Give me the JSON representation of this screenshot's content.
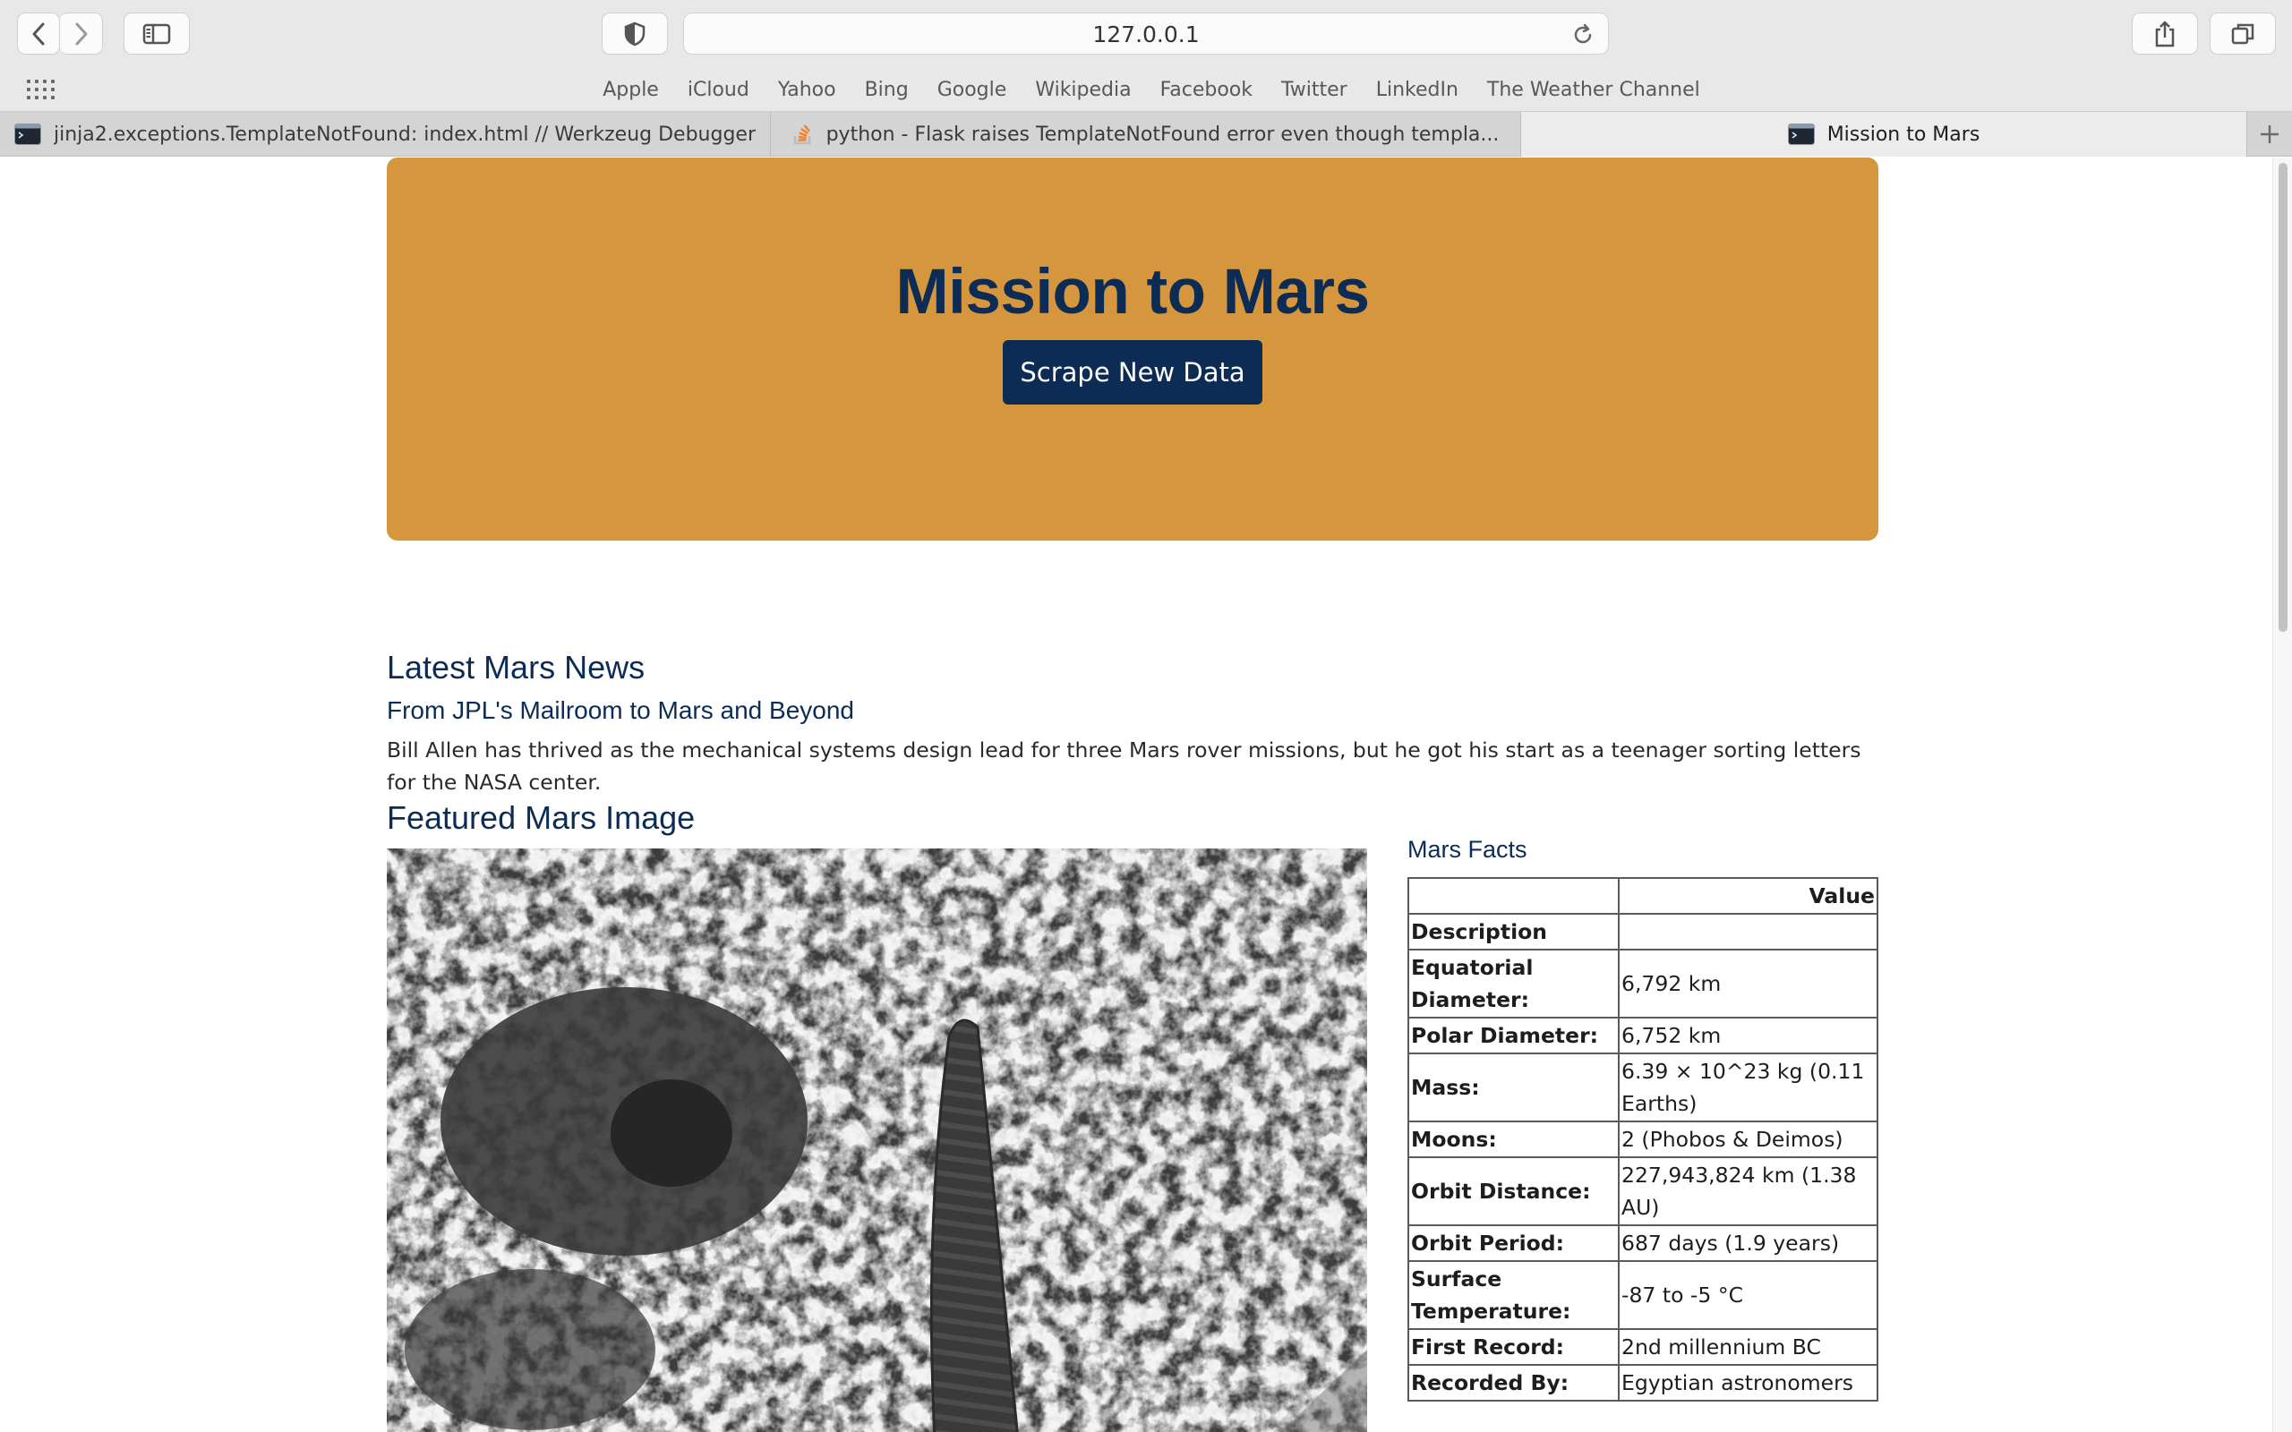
{
  "browser": {
    "url": "127.0.0.1",
    "favorites": [
      "Apple",
      "iCloud",
      "Yahoo",
      "Bing",
      "Google",
      "Wikipedia",
      "Facebook",
      "Twitter",
      "LinkedIn",
      "The Weather Channel"
    ],
    "tabs": [
      {
        "label": "jinja2.exceptions.TemplateNotFound: index.html // Werkzeug Debugger",
        "icon": "terminal-icon",
        "active": false
      },
      {
        "label": "python - Flask raises TemplateNotFound error even though templa...",
        "icon": "stackoverflow-icon",
        "active": false
      },
      {
        "label": "Mission to Mars",
        "icon": "terminal-icon",
        "active": true
      }
    ]
  },
  "page": {
    "title": "Mission to Mars",
    "scrape_button": "Scrape New Data",
    "news": {
      "heading": "Latest Mars News",
      "title": "From JPL's Mailroom to Mars and Beyond",
      "paragraph": "Bill Allen has thrived as the mechanical systems design lead for three Mars rover missions, but he got his start as a teenager sorting letters for the NASA center."
    },
    "featured": {
      "heading": "Featured Mars Image"
    },
    "facts": {
      "heading": "Mars Facts",
      "header_value": "Value",
      "header_description": "Description",
      "rows": [
        {
          "key": "Equatorial Diameter:",
          "value": "6,792 km"
        },
        {
          "key": "Polar Diameter:",
          "value": "6,752 km"
        },
        {
          "key": "Mass:",
          "value": "6.39 × 10^23 kg (0.11 Earths)"
        },
        {
          "key": "Moons:",
          "value": "2 (Phobos & Deimos)"
        },
        {
          "key": "Orbit Distance:",
          "value": "227,943,824 km (1.38 AU)"
        },
        {
          "key": "Orbit Period:",
          "value": "687 days (1.9 years)"
        },
        {
          "key": "Surface Temperature:",
          "value": "-87 to -5 °C"
        },
        {
          "key": "First Record:",
          "value": "2nd millennium BC"
        },
        {
          "key": "Recorded By:",
          "value": "Egyptian astronomers"
        }
      ]
    }
  },
  "colors": {
    "jumbotron": "#d5963d",
    "navy": "#0c2c56"
  }
}
